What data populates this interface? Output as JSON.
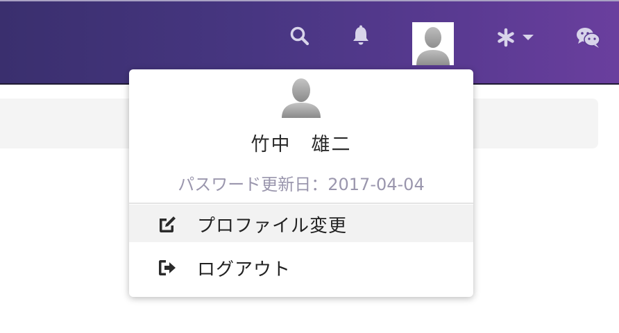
{
  "header": {
    "icons": {
      "search": "search-icon",
      "notifications": "bell-icon",
      "avatar": "user-avatar-icon",
      "settings": "asterisk-icon",
      "settings_caret": "caret-down-icon",
      "chat": "wechat-icon"
    }
  },
  "user_menu": {
    "name": "竹中　雄二",
    "password_updated": "パスワード更新日：2017-04-04",
    "items": [
      {
        "label": "プロファイル変更",
        "icon": "edit-icon"
      },
      {
        "label": "ログアウト",
        "icon": "sign-out-icon"
      }
    ]
  },
  "colors": {
    "header_start": "#3a2f6e",
    "header_end": "#6a3f9e",
    "muted_text": "#9a96ad",
    "hover_bg": "#f2f2f2"
  }
}
